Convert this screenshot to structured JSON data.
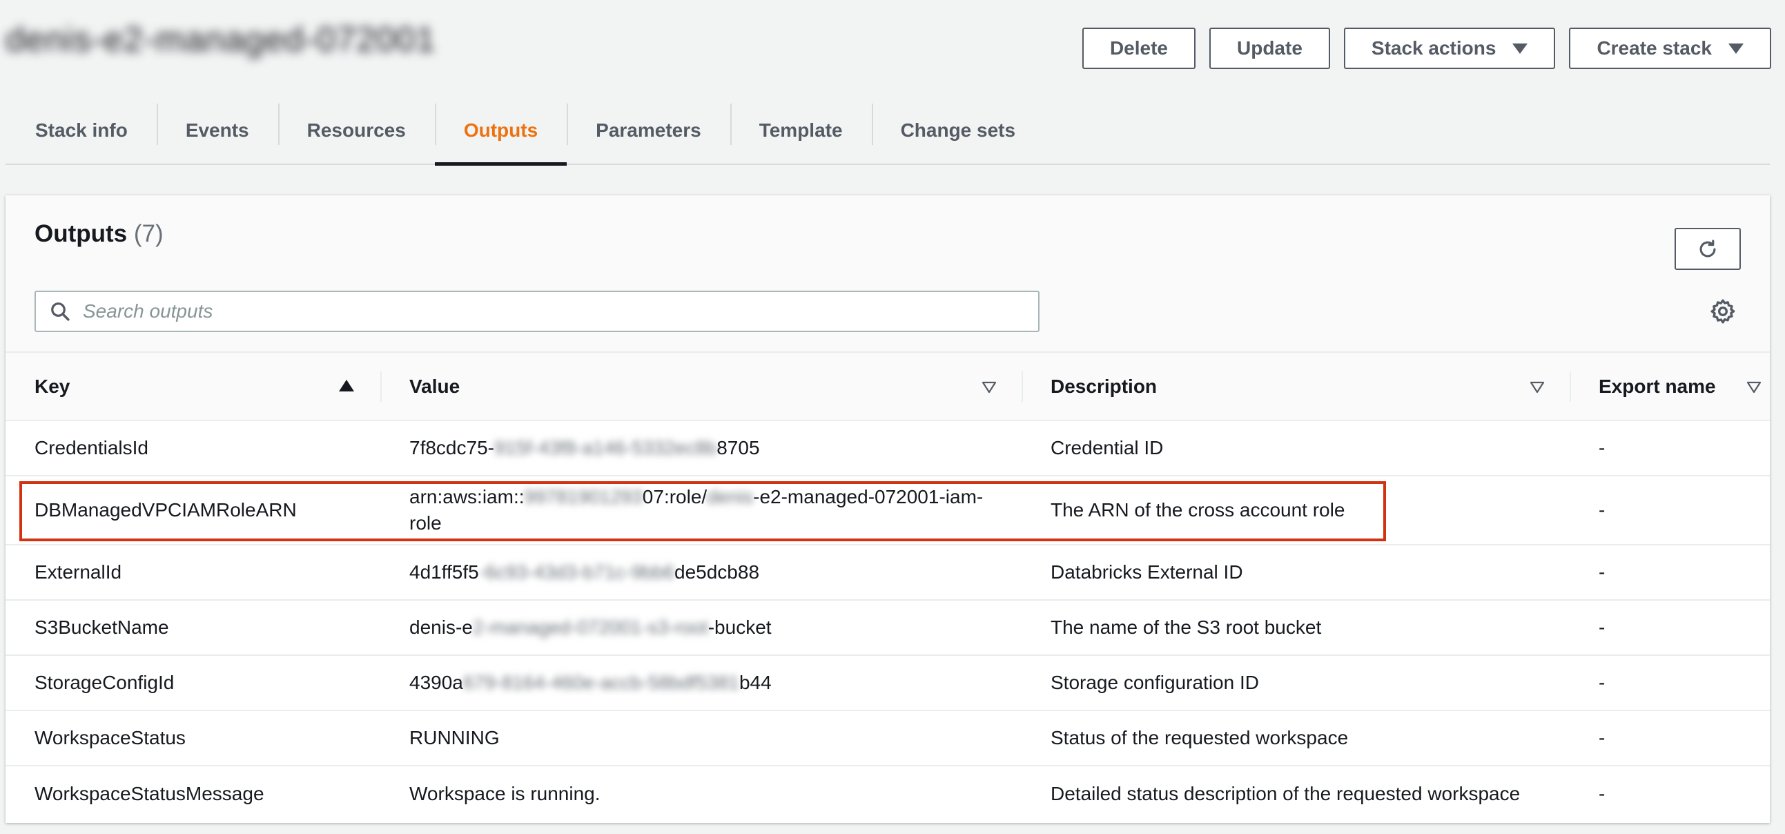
{
  "stack": {
    "name": "denis-e2-managed-072001"
  },
  "header_actions": {
    "delete": "Delete",
    "update": "Update",
    "stack_actions": "Stack actions",
    "create_stack": "Create stack"
  },
  "tabs": [
    {
      "label": "Stack info"
    },
    {
      "label": "Events"
    },
    {
      "label": "Resources"
    },
    {
      "label": "Outputs",
      "active": true
    },
    {
      "label": "Parameters"
    },
    {
      "label": "Template"
    },
    {
      "label": "Change sets"
    }
  ],
  "outputs": {
    "title": "Outputs",
    "count": "(7)",
    "search_placeholder": "Search outputs",
    "columns": {
      "key": "Key",
      "value": "Value",
      "description": "Description",
      "export_name": "Export name"
    },
    "rows": [
      {
        "key": "CredentialsId",
        "value_pre": "7f8cdc75-",
        "value_blur": "915f-43f8-a146-5332ec8b",
        "value_post": "8705",
        "description": "Credential ID",
        "export": "-"
      },
      {
        "key": "DBManagedVPCIAMRoleARN",
        "value_pre": "arn:aws:iam::",
        "value_blur": "99781901293",
        "value_mid": "07:role/",
        "value_blur2": "denis",
        "value_post": "-e2-managed-072001-iam-role",
        "description": "The ARN of the cross account role",
        "export": "-"
      },
      {
        "key": "ExternalId",
        "value_pre": "4d1ff5f5",
        "value_blur": "-6c93-43d3-b71c-9bb6",
        "value_post": "de5dcb88",
        "description": "Databricks External ID",
        "export": "-"
      },
      {
        "key": "S3BucketName",
        "value_pre": "denis-e",
        "value_blur": "2-managed-072001-s3-root",
        "value_post": "-bucket",
        "description": "The name of the S3 root bucket",
        "export": "-"
      },
      {
        "key": "StorageConfigId",
        "value_pre": "4390a",
        "value_blur": "679-8164-460e-accb-58bdf5381",
        "value_post": "b44",
        "description": "Storage configuration ID",
        "export": "-"
      },
      {
        "key": "WorkspaceStatus",
        "value_pre": "RUNNING",
        "value_blur": "",
        "value_post": "",
        "description": "Status of the requested workspace",
        "export": "-"
      },
      {
        "key": "WorkspaceStatusMessage",
        "value_pre": "Workspace is running.",
        "value_blur": "",
        "value_post": "",
        "description": "Detailed status description of the requested workspace",
        "export": "-"
      }
    ]
  },
  "colors": {
    "accent": "#ec7211",
    "highlight": "#d13212",
    "text": "#16191f",
    "muted": "#687078"
  }
}
